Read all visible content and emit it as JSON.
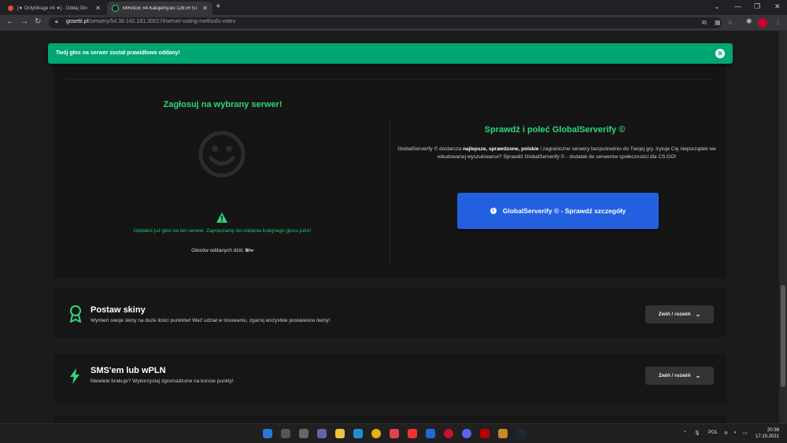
{
  "browser": {
    "tabs": [
      {
        "title": "[★ OnlyMirage #4 ★] - Oddaj Gło"
      },
      {
        "title": "MIRAGE #4 Katujemy.eu 128TR ST"
      }
    ],
    "url_host": "gosetti.pl",
    "url_path": "/serwery/54.38.142.181:30017#server-voting-methods-votes"
  },
  "toast": {
    "message": "Twój głos na serwer został prawidłowo oddany!"
  },
  "vote": {
    "title": "Zagłosuj na wybrany serwer!",
    "already_voted": "Oddałeś już głos na ten serwer. Zapraszamy do oddania kolejnego głosu jutro!",
    "votes_today_label": "Głosów oddanych dziś:",
    "votes_today_value": "6/∞"
  },
  "globalserverify": {
    "title": "Sprawdź i poleć GlobalServerify ©",
    "desc_1": "GlobalServerify © dostarcza ",
    "desc_bold": "najlepsze, sprawdzone, polskie",
    "desc_2": " i zagraniczne serwery bezpośrednio do Twojej gry. Irytuje Cię nieporządek we wbudowanej wyszukiwarce? Sprawdź GlobalServerify © - dodatek do serwerów społeczności dla CS:GO!",
    "button_label": "GlobalServerify © - Sprawdź szczegóły"
  },
  "sections": [
    {
      "title": "Postaw skiny",
      "desc": "Wymień swoje skiny na duże ilości punktów! Weź udział w losowaniu, zgarnij wszystkie postawione itemy!",
      "toggle": "Zwiń / rozwiń"
    },
    {
      "title": "SMS'em lub wPLN",
      "desc": "Niewiele brakuje? Wykorzystaj zgromadzone na koncie punkty!",
      "toggle": "Zwiń / rozwiń"
    }
  ],
  "taskbar": {
    "lang": "POL",
    "time": "20:38",
    "date": "17.10.2021"
  },
  "colors": {
    "accent_green": "#2fd77c",
    "toast_green": "#00a672",
    "button_blue": "#2260e0"
  }
}
